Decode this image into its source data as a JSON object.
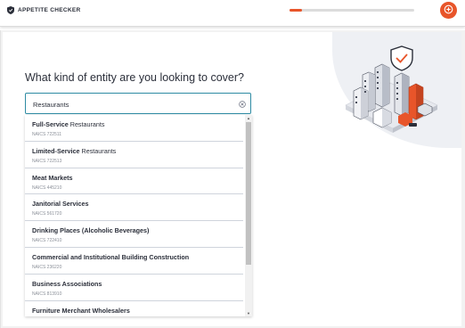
{
  "app": {
    "brand_name": "APPETITE CHECKER",
    "logo_icon": "shield-logo-icon"
  },
  "header": {
    "progress_fraction": 0.1,
    "progress_color": "#e8552a",
    "action_icon": "plus-circle-icon"
  },
  "main": {
    "question": "What kind of entity are you looking to cover?",
    "illustration_icon": "city-buildings-shield-illustration"
  },
  "search": {
    "value": "Restaurants",
    "clear_icon": "clear-circle-icon"
  },
  "results": [
    {
      "bold": "Full-Service",
      "rest": " Restaurants",
      "code": "NAICS 722511"
    },
    {
      "bold": "Limited-Service",
      "rest": " Restaurants",
      "code": "NAICS 722513"
    },
    {
      "bold": "Meat Markets",
      "rest": "",
      "code": "NAICS 445210"
    },
    {
      "bold": "Janitorial Services",
      "rest": "",
      "code": "NAICS 561720"
    },
    {
      "bold": "Drinking Places (Alcoholic Beverages)",
      "rest": "",
      "code": "NAICS 722410"
    },
    {
      "bold": "Commercial and Institutional Building Construction",
      "rest": "",
      "code": "NAICS 236220"
    },
    {
      "bold": "Business Associations",
      "rest": "",
      "code": "NAICS 813910"
    },
    {
      "bold": "Furniture Merchant Wholesalers",
      "rest": "",
      "code": ""
    }
  ],
  "colors": {
    "accent": "#e8552a",
    "focus_border": "#2e8ba3",
    "text": "#2b2f3a"
  }
}
